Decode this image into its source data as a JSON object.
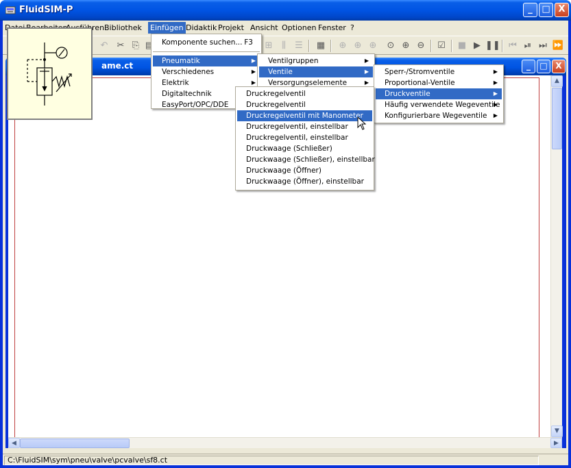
{
  "window": {
    "title": "FluidSIM-P",
    "minimize": "_",
    "maximize": "□",
    "close": "X"
  },
  "menubar": [
    "Datei",
    "Bearbeiten",
    "Ausführen",
    "Bibliothek",
    "Einfügen",
    "Didaktik",
    "Projekt",
    "Ansicht",
    "Optionen",
    "Fenster",
    "?"
  ],
  "toolbar": {
    "icons": [
      "undo-icon",
      "cut-icon",
      "copy-icon",
      "paste-icon",
      "align-icon",
      "distribute-icon",
      "align-v-icon",
      "grid-icon",
      "zoom-component-icon",
      "zoom-window-icon",
      "zoom-extent-icon",
      "zoom-fit-icon",
      "zoom-in-icon",
      "zoom-out-icon",
      "check-icon",
      "stop-icon",
      "play-icon",
      "pause-icon",
      "rewind-icon",
      "step-icon",
      "end-icon",
      "forward-icon"
    ]
  },
  "mdi": {
    "title": "ame.ct"
  },
  "status": {
    "path": "C:\\FluidSIM\\sym\\pneu\\valve\\pcvalve\\sf8.ct"
  },
  "menus": {
    "einfuegen": {
      "search": "Komponente suchen...",
      "search_accel": "F3",
      "items": [
        "Pneumatik",
        "Verschiedenes",
        "Elektrik",
        "Digitaltechnik",
        "EasyPort/OPC/DDE"
      ]
    },
    "pneumatik": [
      "Ventilgruppen",
      "Ventile",
      "Versorgungselemente"
    ],
    "ventile": [
      "Sperr-/Stromventile",
      "Proportional-Ventile",
      "Druckventile",
      "Häufig verwendete Wegeventile",
      "Konfigurierbare Wegeventile"
    ],
    "druckventile": [
      "Druckregelventil",
      "Druckregelventil",
      "Druckregelventil mit Manometer",
      "Druckregelventil, einstellbar",
      "Druckregelventil, einstellbar",
      "Druckwaage (Schließer)",
      "Druckwaage (Schließer), einstellbar",
      "Druckwaage (Öffner)",
      "Druckwaage (Öffner), einstellbar"
    ]
  },
  "colors": {
    "highlight": "#316ac5",
    "titlebar": "#0054e3",
    "chrome": "#ece9d8",
    "tooltip": "#ffffe1"
  }
}
